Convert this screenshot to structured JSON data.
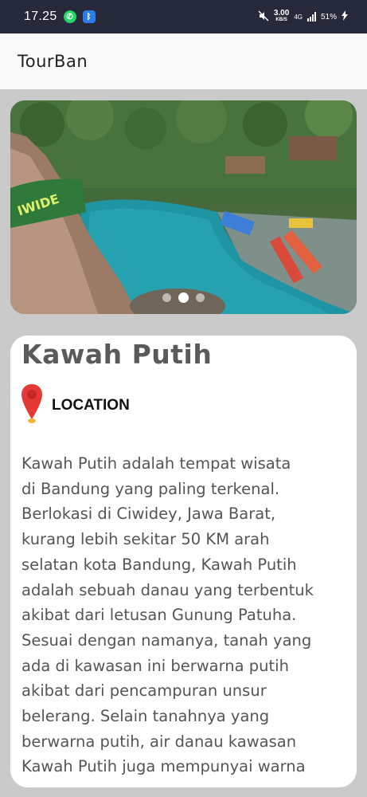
{
  "status_bar": {
    "time": "17.25",
    "whatsapp_icon": "whatsapp-icon",
    "bluetooth_icon": "bluetooth-icon",
    "mute_icon": "mute-icon",
    "speed_value": "3.00",
    "speed_unit": "KB/S",
    "network": "4G",
    "battery_text": "51%",
    "charging_icon": "charging-bolt-icon"
  },
  "app_bar": {
    "title": "TourBan"
  },
  "carousel": {
    "image_description_icon": "photo-slide",
    "dot_count": 3,
    "active_dot_index": 1
  },
  "detail": {
    "title": "Kawah Putih",
    "location_label": "LOCATION",
    "location_icon": "map-pin-icon",
    "pin_color": "#e53935",
    "description": "Kawah Putih adalah tempat wisata\ndi Bandung yang paling terkenal.\nBerlokasi di Ciwidey, Jawa Barat,\nkurang lebih sekitar 50 KM arah\nselatan kota Bandung, Kawah Putih\nadalah sebuah danau yang terbentuk\nakibat dari letusan Gunung Patuha.\nSesuai dengan namanya, tanah yang\nada di kawasan ini berwarna putih\nakibat dari pencampuran unsur\nbelerang. Selain tanahnya yang\nberwarna putih, air danau kawasan\nKawah Putih juga mempunyai warna"
  },
  "colors": {
    "status_bar_bg": "#26293a",
    "page_bg": "#c9cac9",
    "card_bg": "#ffffff",
    "text_gray": "#555555"
  }
}
